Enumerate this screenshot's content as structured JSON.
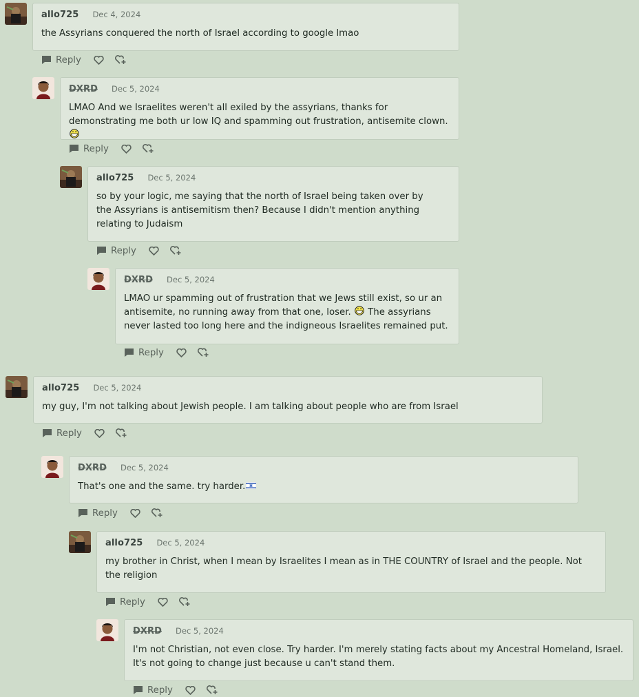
{
  "comments": [
    {
      "username": "allo725",
      "date": "Dec 4, 2024",
      "text": "the Assyrians conquered the north of Israel according to google lmao",
      "avatar": "allo-avatar"
    },
    {
      "username": "DXRD",
      "date": "Dec 5, 2024",
      "text": "LMAO And we Israelites weren't all exiled by the assyrians, thanks for demonstrating me both ur low IQ and spamming out frustration, antisemite clown.",
      "avatar": "dxrd-avatar",
      "emoji": "grin-emoji"
    },
    {
      "username": "allo725",
      "date": "Dec 5, 2024",
      "text": "so by your logic, me saying that the north of Israel being taken over by the Assyrians is antisemitism then? Because I didn't mention anything relating to Judaism",
      "avatar": "allo-avatar"
    },
    {
      "username": "DXRD",
      "date": "Dec 5, 2024",
      "text_before": "LMAO ur spamming out of frustration that we Jews still exist, so ur an antisemite, no running away from that one, loser.",
      "text_after": "The assyrians never lasted too long here and the indigneous Israelites remained put.",
      "avatar": "dxrd-avatar",
      "emoji": "grin-emoji"
    },
    {
      "username": "allo725",
      "date": "Dec 5, 2024",
      "text": "my guy, I'm not talking about Jewish people. I am talking about people who are from Israel",
      "avatar": "allo-avatar"
    },
    {
      "username": "DXRD",
      "date": "Dec 5, 2024",
      "text": "That's one and the same. try harder.",
      "avatar": "dxrd-avatar",
      "emoji": "israel-flag-icon"
    },
    {
      "username": "allo725",
      "date": "Dec 5, 2024",
      "text": "my brother in Christ, when I mean by Israelites I mean as in THE COUNTRY of Israel and the people. Not the religion",
      "avatar": "allo-avatar"
    },
    {
      "username": "DXRD",
      "date": "Dec 5, 2024",
      "text": "I'm not Christian, not even close. Try harder. I'm merely stating facts about my Ancestral Homeland, Israel. It's not going to change just because u can't stand them.",
      "avatar": "dxrd-avatar"
    }
  ],
  "actions": {
    "reply_label": "Reply",
    "like_icon": "heart-icon",
    "react_icon": "add-reaction-icon",
    "reply_icon": "reply-bubble-icon"
  },
  "colors": {
    "background": "#cfdccb",
    "bubble": "#dfe7dc",
    "border": "#c0cdbd",
    "text": "#1f2a22",
    "muted": "#6b756e"
  }
}
